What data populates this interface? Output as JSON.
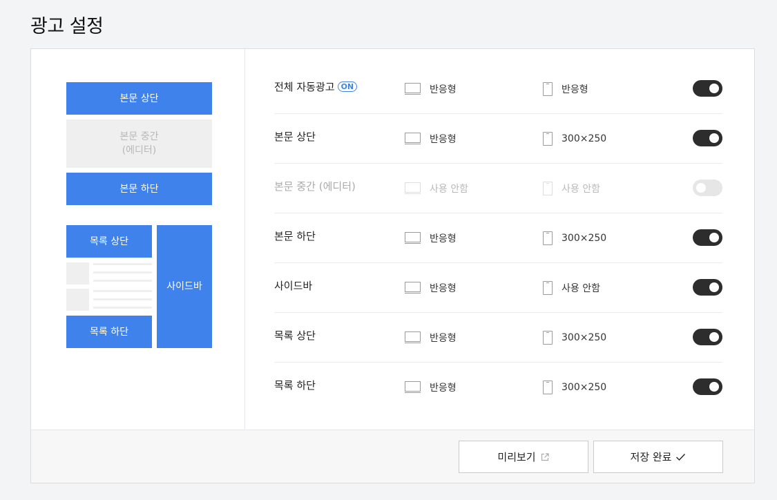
{
  "page": {
    "title": "광고 설정"
  },
  "preview": {
    "body_top": "본문 상단",
    "body_middle_line1": "본문 중간",
    "body_middle_line2": "(에디터)",
    "body_bottom": "본문 하단",
    "list_top": "목록 상단",
    "list_bottom": "목록 하단",
    "sidebar": "사이드바"
  },
  "settings": {
    "rows": [
      {
        "label": "전체 자동광고",
        "badge": "ON",
        "pc": "반응형",
        "mobile": "반응형",
        "enabled": true
      },
      {
        "label": "본문 상단",
        "pc": "반응형",
        "mobile": "300×250",
        "enabled": true
      },
      {
        "label": "본문 중간 (에디터)",
        "pc": "사용 안함",
        "mobile": "사용 안함",
        "enabled": false
      },
      {
        "label": "본문 하단",
        "pc": "반응형",
        "mobile": "300×250",
        "enabled": true
      },
      {
        "label": "사이드바",
        "pc": "반응형",
        "mobile": "사용 안함",
        "enabled": true
      },
      {
        "label": "목록 상단",
        "pc": "반응형",
        "mobile": "300×250",
        "enabled": true
      },
      {
        "label": "목록 하단",
        "pc": "반응형",
        "mobile": "300×250",
        "enabled": true
      }
    ]
  },
  "footer": {
    "preview_button": "미리보기",
    "save_button": "저장 완료"
  },
  "icons": {
    "pc": "monitor-icon",
    "mobile": "phone-icon",
    "external": "external-link-icon",
    "check": "check-icon"
  },
  "colors": {
    "accent": "#3f82eb",
    "toggle_on": "#2d2d2d",
    "toggle_off": "#e6e6e6",
    "slot_disabled": "#efefef"
  }
}
